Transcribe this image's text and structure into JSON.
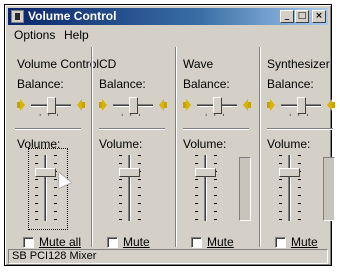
{
  "window": {
    "title": "Volume Control",
    "controls": [
      "minimize-icon",
      "maximize-icon",
      "close-icon"
    ]
  },
  "menu": [
    "Options",
    "Help"
  ],
  "balance_label": "Balance:",
  "volume_label": "Volume:",
  "channels": [
    {
      "name": "Volume Control",
      "mute_label": "Mute all",
      "muted": false,
      "volume_level": 0.75,
      "balance": 0.5
    },
    {
      "name": "CD",
      "mute_label": "Mute",
      "muted": false,
      "volume_level": 0.75,
      "balance": 0.5
    },
    {
      "name": "Wave",
      "mute_label": "Mute",
      "muted": false,
      "volume_level": 0.75,
      "balance": 0.5
    },
    {
      "name": "Synthesizer",
      "mute_label": "Mute",
      "muted": false,
      "volume_level": 0.75,
      "balance": 0.5
    }
  ],
  "status_bar": "SB PCI128 Mixer"
}
